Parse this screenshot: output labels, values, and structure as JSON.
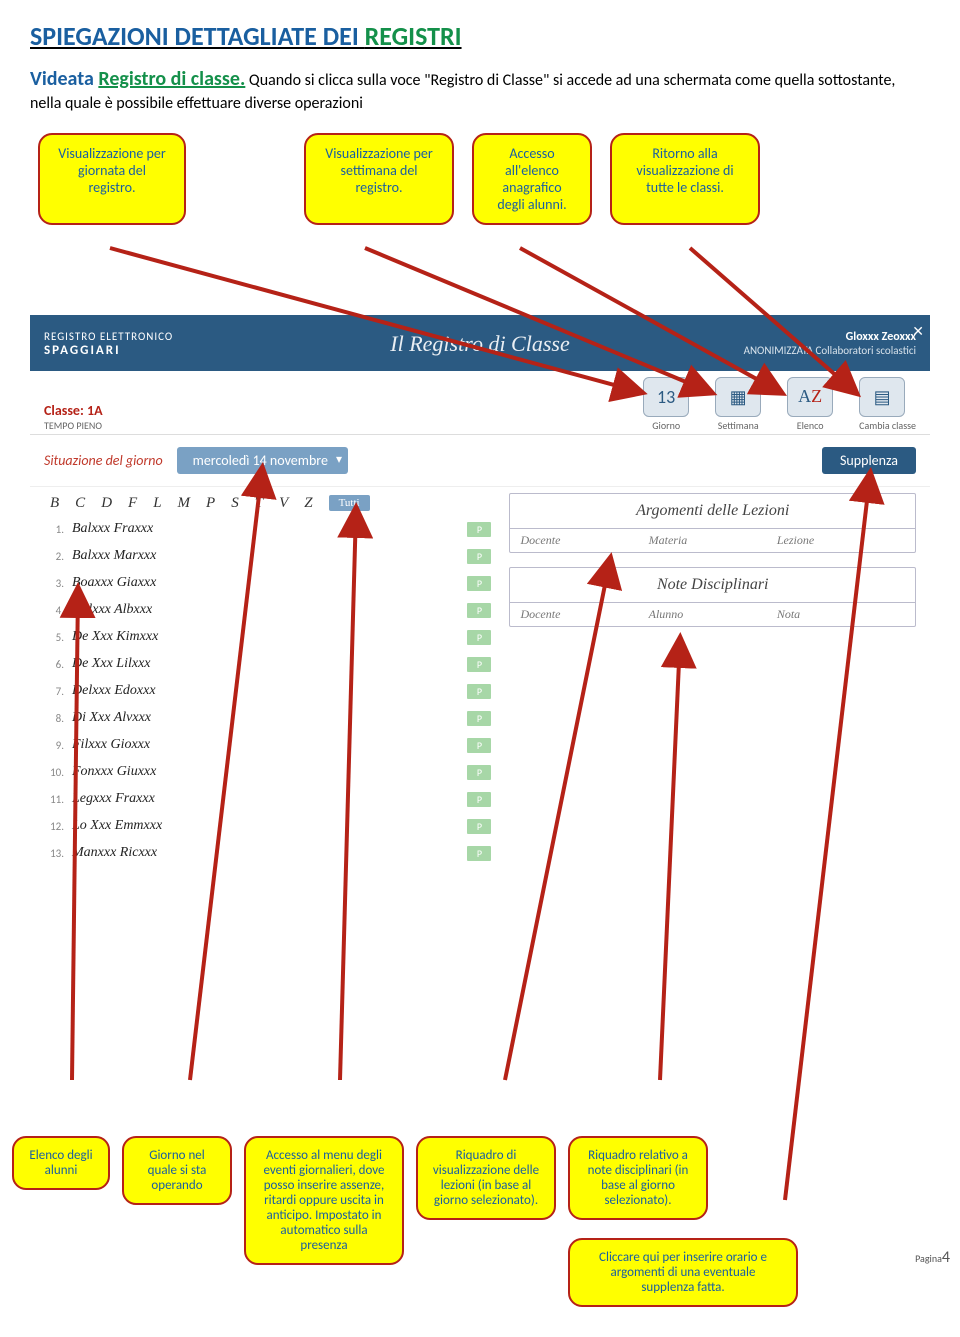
{
  "title": {
    "part1": "SPIEGAZIONI DETTAGLIATE DEI ",
    "part2": "REGISTRI"
  },
  "intro": {
    "prefix1": "Videata ",
    "prefix2": "Registro di classe.",
    "body": " Quando si clicca sulla voce \"Registro di Classe\" si accede ad una schermata come quella sottostante, nella quale è possibile effettuare diverse operazioni"
  },
  "callouts_top": {
    "c1": "Visualizzazione per giornata del registro.",
    "c2": "Visualizzazione per settimana del registro.",
    "c3": "Accesso all'elenco anagrafico degli alunni.",
    "c4": "Ritorno alla visualizzazione di tutte le classi."
  },
  "app": {
    "logo1": "REGISTRO ELETTRONICO",
    "logo2": "SPAGGIARI",
    "title": "Il Registro di Classe",
    "username": "Gloxxx Zeoxxx",
    "userrole": "ANONIMIZZATA Collaboratori scolastici"
  },
  "class": {
    "name": "Classe: 1A",
    "sub": "TEMPO PIENO"
  },
  "nav": {
    "giorno": "Giorno",
    "settimana": "Settimana",
    "elenco": "Elenco",
    "cambia": "Cambia classe",
    "giorno_num": "13"
  },
  "situ": {
    "label": "Situazione del giorno",
    "date": "mercoledì 14 novembre",
    "supplenza": "Supplenza"
  },
  "letters": [
    "B",
    "C",
    "D",
    "F",
    "L",
    "M",
    "P",
    "S",
    "T",
    "V",
    "Z"
  ],
  "tutti": "Tutti",
  "students": [
    "Balxxx Fraxxx",
    "Balxxx Marxxx",
    "Boaxxx Giaxxx",
    "Calxxx Albxxx",
    "De Xxx Kimxxx",
    "De Xxx Lilxxx",
    "Delxxx Edoxxx",
    "Di Xxx Alvxxx",
    "Filxxx Gioxxx",
    "Fonxxx Giuxxx",
    "Legxxx Fraxxx",
    "Lo Xxx Emmxxx",
    "Manxxx Ricxxx"
  ],
  "p_tag": "P",
  "right": {
    "box1_title": "Argomenti delle Lezioni",
    "box1_h1": "Docente",
    "box1_h2": "Materia",
    "box1_h3": "Lezione",
    "box2_title": "Note Disciplinari",
    "box2_h1": "Docente",
    "box2_h2": "Alunno",
    "box2_h3": "Nota"
  },
  "callouts_bottom": {
    "c1": "Elenco degli alunni",
    "c2": "Giorno nel quale si sta operando",
    "c3": "Accesso al menu degli eventi giornalieri, dove posso inserire assenze, ritardi oppure uscita in anticipo. Impostato in automatico sulla presenza",
    "c4": "Riquadro di visualizzazione delle lezioni (in base al giorno selezionato).",
    "c5": "Riquadro relativo a note disciplinari (in base al giorno selezionato).",
    "c6": "Cliccare qui per inserire orario e argomenti di una eventuale supplenza fatta."
  },
  "page_num": {
    "label": "Pagina",
    "num": "4"
  }
}
